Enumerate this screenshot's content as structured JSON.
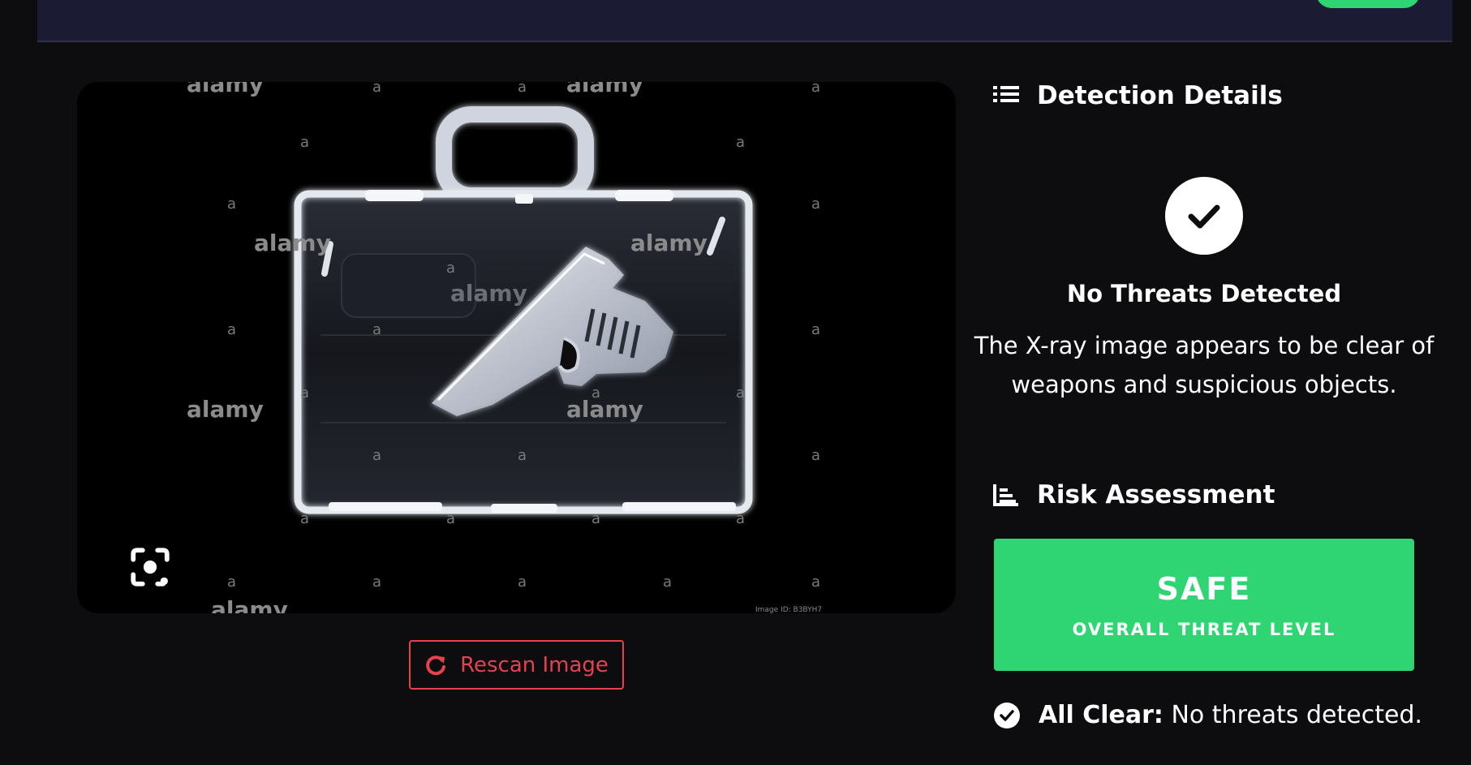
{
  "image": {
    "watermark_brand": "alamy",
    "watermark_mark": "a",
    "watermark_id": "Image ID: B3BYH7",
    "icon": "xray-briefcase-pistol-image"
  },
  "lens": {
    "icon": "camera-lens-icon"
  },
  "rescan": {
    "label": "Rescan Image",
    "icon": "refresh-icon"
  },
  "details": {
    "heading": "Detection Details",
    "icon": "list-icon",
    "status_icon": "check-circle-icon",
    "status_title": "No Threats Detected",
    "status_desc": "The X-ray image appears to be clear of weapons and suspicious objects."
  },
  "risk": {
    "heading": "Risk Assessment",
    "icon": "bar-chart-icon",
    "level": "SAFE",
    "caption": "OVERALL THREAT LEVEL",
    "summary_label": "All Clear:",
    "summary_text": " No threats detected.",
    "summary_icon": "check-circle-icon"
  },
  "colors": {
    "background": "#0d0d0f",
    "header": "#1b1c33",
    "safe": "#2fd573",
    "danger": "#e6414f"
  }
}
